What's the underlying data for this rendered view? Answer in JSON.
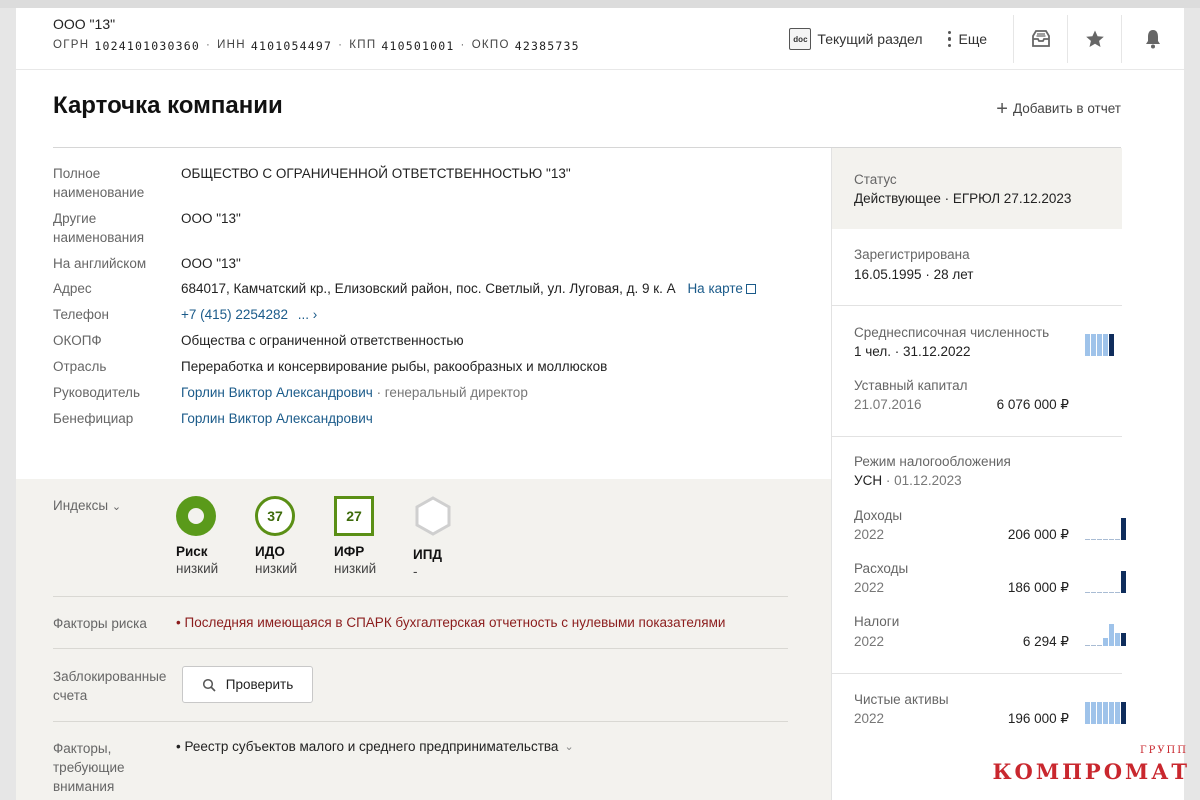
{
  "header": {
    "company_short": "ООО \"13\"",
    "ids": [
      {
        "label": "ОГРН",
        "value": "1024101030360"
      },
      {
        "label": "ИНН",
        "value": "4101054497"
      },
      {
        "label": "КПП",
        "value": "410501001"
      },
      {
        "label": "ОКПО",
        "value": "42385735"
      }
    ],
    "current_section_label": "Текущий раздел",
    "more_label": "Еще",
    "doc_icon_text": "doc"
  },
  "page": {
    "title": "Карточка компании",
    "add_to_report": "Добавить в отчет"
  },
  "details": {
    "full_name": {
      "label": "Полное наименование",
      "value": "ОБЩЕСТВО С ОГРАНИЧЕННОЙ ОТВЕТСТВЕННОСТЬЮ \"13\""
    },
    "other_names": {
      "label": "Другие наименования",
      "value": "ООО \"13\""
    },
    "english": {
      "label": "На английском",
      "value": "ООО \"13\""
    },
    "address": {
      "label": "Адрес",
      "value": "684017, Камчатский кр., Елизовский район, пос. Светлый, ул. Луговая, д. 9 к. А",
      "map_link": "На карте"
    },
    "phone": {
      "label": "Телефон",
      "value": "+7 (415) 2254282",
      "more": "..."
    },
    "okopf": {
      "label": "ОКОПФ",
      "value": "Общества с ограниченной ответственностью"
    },
    "industry": {
      "label": "Отрасль",
      "value": "Переработка и консервирование рыбы, ракообразных и моллюсков"
    },
    "head": {
      "label": "Руководитель",
      "name": "Горлин Виктор Александрович",
      "role": "· генеральный директор"
    },
    "beneficiary": {
      "label": "Бенефициар",
      "name": "Горлин Виктор Александрович"
    }
  },
  "indices": {
    "label": "Индексы",
    "items": [
      {
        "name": "Риск",
        "value": "",
        "level": "низкий"
      },
      {
        "name": "ИДО",
        "value": "37",
        "level": "низкий"
      },
      {
        "name": "ИФР",
        "value": "27",
        "level": "низкий"
      },
      {
        "name": "ИПД",
        "value": "",
        "level": "-"
      }
    ]
  },
  "risk_factors": {
    "label": "Факторы риска",
    "item": "Последняя имеющаяся в СПАРК бухгалтерская отчетность с нулевыми показателями"
  },
  "blocked_accounts": {
    "label_line1": "Заблокированные",
    "label_line2": "счета",
    "button": "Проверить"
  },
  "attention_factors": {
    "label_line1": "Факторы,",
    "label_line2": "требующие",
    "label_line3": "внимания",
    "item": "Реестр субъектов малого и среднего предпринимательства"
  },
  "side": {
    "status": {
      "label": "Статус",
      "value": "Действующее · ЕГРЮЛ 27.12.2023"
    },
    "registered": {
      "label": "Зарегистрирована",
      "value": "16.05.1995 · 28 лет"
    },
    "headcount": {
      "label": "Среднесписочная численность",
      "value": "1 чел. · 31.12.2022",
      "bars": [
        1,
        1,
        1,
        1,
        1
      ]
    },
    "capital": {
      "label": "Уставный капитал",
      "date": "21.07.2016",
      "amount": "6 076 000 ₽"
    },
    "tax": {
      "label": "Режим налогообложения",
      "regime": "УСН",
      "date": "· 01.12.2023"
    },
    "income": {
      "label": "Доходы",
      "year": "2022",
      "amount": "206 000 ₽",
      "bars": [
        0,
        0,
        0,
        0,
        0,
        0,
        1
      ]
    },
    "expenses": {
      "label": "Расходы",
      "year": "2022",
      "amount": "186 000 ₽",
      "bars": [
        0,
        0,
        0,
        0,
        0,
        0,
        1
      ]
    },
    "taxes": {
      "label": "Налоги",
      "year": "2022",
      "amount": "6 294 ₽",
      "bars": [
        0,
        0,
        0,
        0.35,
        1,
        0.6,
        0.6
      ]
    },
    "net_assets": {
      "label": "Чистые активы",
      "year": "2022",
      "amount": "196 000 ₽",
      "bars": [
        1,
        1,
        1,
        1,
        1,
        1,
        1
      ]
    }
  },
  "watermark": {
    "main": "КОМПРОМАТ",
    "small": "ГРУПП"
  }
}
